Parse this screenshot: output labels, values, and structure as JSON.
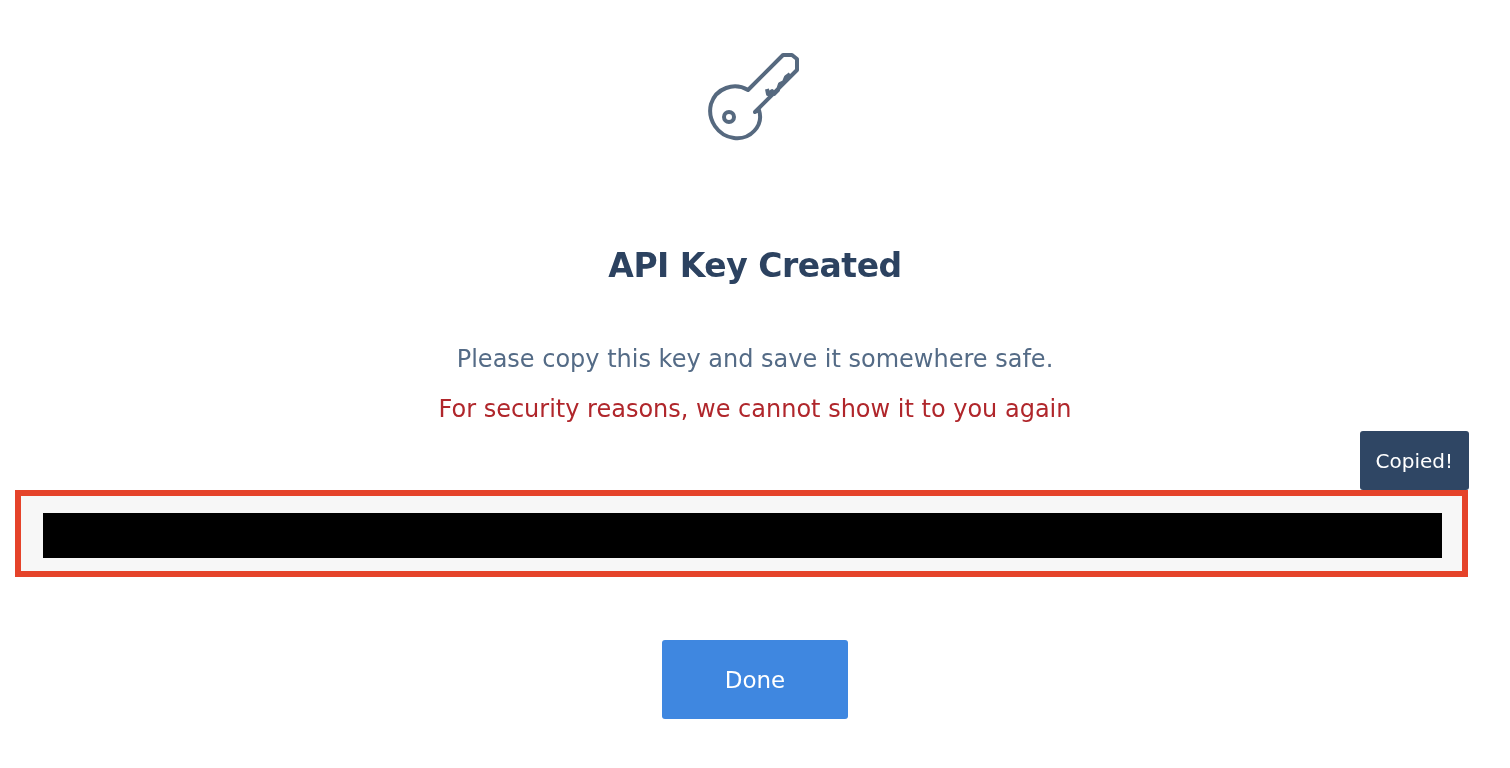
{
  "dialog": {
    "title": "API Key Created",
    "message": "Please copy this key and save it somewhere safe.",
    "warning": "For security reasons, we cannot show it to you again",
    "tooltip": "Copied!",
    "key_field": {
      "highlighted": true,
      "redacted": true
    },
    "buttons": [
      "Done"
    ]
  }
}
